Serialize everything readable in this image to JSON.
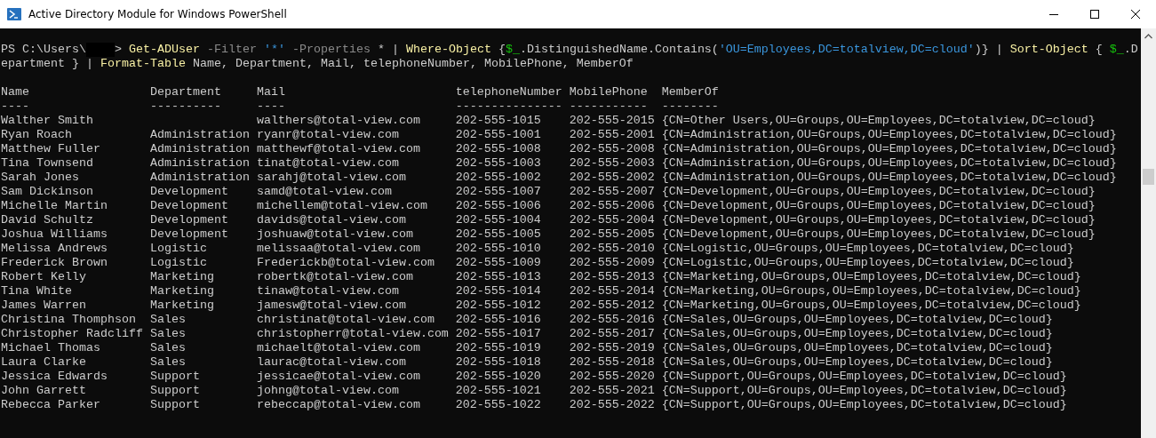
{
  "window": {
    "title": "Active Directory Module for Windows PowerShell"
  },
  "command_lines": [
    [
      {
        "kind": "plain",
        "text": "PS C:\\Users\\"
      },
      {
        "kind": "redacted"
      },
      {
        "kind": "plain",
        "text": "> "
      },
      {
        "kind": "command",
        "text": "Get-ADUser"
      },
      {
        "kind": "parameter",
        "text": " -Filter"
      },
      {
        "kind": "string",
        "text": " '*'"
      },
      {
        "kind": "parameter",
        "text": " -Properties"
      },
      {
        "kind": "plain",
        "text": " * | "
      },
      {
        "kind": "command",
        "text": "Where-Object"
      },
      {
        "kind": "plain",
        "text": " {"
      },
      {
        "kind": "variable",
        "text": "$_"
      },
      {
        "kind": "plain",
        "text": ".DistinguishedName.Contains("
      },
      {
        "kind": "string",
        "text": "'OU=Employees,DC=totalview,DC=cloud'"
      },
      {
        "kind": "plain",
        "text": ")} | "
      },
      {
        "kind": "command",
        "text": "Sort-Object"
      },
      {
        "kind": "plain",
        "text": " { "
      },
      {
        "kind": "variable",
        "text": "$_"
      },
      {
        "kind": "plain",
        "text": ".D"
      }
    ],
    [
      {
        "kind": "plain",
        "text": "epartment } | "
      },
      {
        "kind": "command",
        "text": "Format-Table"
      },
      {
        "kind": "plain",
        "text": " Name, Department, Mail, telephoneNumber, MobilePhone, MemberOf"
      }
    ]
  ],
  "table": {
    "columns": [
      {
        "heading": "Name",
        "rule": "----"
      },
      {
        "heading": "Department",
        "rule": "----------"
      },
      {
        "heading": "Mail",
        "rule": "----"
      },
      {
        "heading": "telephoneNumber",
        "rule": "---------------"
      },
      {
        "heading": "MobilePhone",
        "rule": "-----------"
      },
      {
        "heading": "MemberOf",
        "rule": "--------"
      }
    ],
    "rows": [
      [
        "Walther Smith",
        "",
        "walthers@total-view.com",
        "202-555-1015",
        "202-555-2015",
        "{CN=Other Users,OU=Groups,OU=Employees,DC=totalview,DC=cloud}"
      ],
      [
        "Ryan Roach",
        "Administration",
        "ryanr@total-view.com",
        "202-555-1001",
        "202-555-2001",
        "{CN=Administration,OU=Groups,OU=Employees,DC=totalview,DC=cloud}"
      ],
      [
        "Matthew Fuller",
        "Administration",
        "matthewf@total-view.com",
        "202-555-1008",
        "202-555-2008",
        "{CN=Administration,OU=Groups,OU=Employees,DC=totalview,DC=cloud}"
      ],
      [
        "Tina Townsend",
        "Administration",
        "tinat@total-view.com",
        "202-555-1003",
        "202-555-2003",
        "{CN=Administration,OU=Groups,OU=Employees,DC=totalview,DC=cloud}"
      ],
      [
        "Sarah Jones",
        "Administration",
        "sarahj@total-view.com",
        "202-555-1002",
        "202-555-2002",
        "{CN=Administration,OU=Groups,OU=Employees,DC=totalview,DC=cloud}"
      ],
      [
        "Sam Dickinson",
        "Development",
        "samd@total-view.com",
        "202-555-1007",
        "202-555-2007",
        "{CN=Development,OU=Groups,OU=Employees,DC=totalview,DC=cloud}"
      ],
      [
        "Michelle Martin",
        "Development",
        "michellem@total-view.com",
        "202-555-1006",
        "202-555-2006",
        "{CN=Development,OU=Groups,OU=Employees,DC=totalview,DC=cloud}"
      ],
      [
        "David Schultz",
        "Development",
        "davids@total-view.com",
        "202-555-1004",
        "202-555-2004",
        "{CN=Development,OU=Groups,OU=Employees,DC=totalview,DC=cloud}"
      ],
      [
        "Joshua Williams",
        "Development",
        "joshuaw@total-view.com",
        "202-555-1005",
        "202-555-2005",
        "{CN=Development,OU=Groups,OU=Employees,DC=totalview,DC=cloud}"
      ],
      [
        "Melissa Andrews",
        "Logistic",
        "melissaa@total-view.com",
        "202-555-1010",
        "202-555-2010",
        "{CN=Logistic,OU=Groups,OU=Employees,DC=totalview,DC=cloud}"
      ],
      [
        "Frederick Brown",
        "Logistic",
        "Frederickb@total-view.com",
        "202-555-1009",
        "202-555-2009",
        "{CN=Logistic,OU=Groups,OU=Employees,DC=totalview,DC=cloud}"
      ],
      [
        "Robert Kelly",
        "Marketing",
        "robertk@total-view.com",
        "202-555-1013",
        "202-555-2013",
        "{CN=Marketing,OU=Groups,OU=Employees,DC=totalview,DC=cloud}"
      ],
      [
        "Tina White",
        "Marketing",
        "tinaw@total-view.com",
        "202-555-1014",
        "202-555-2014",
        "{CN=Marketing,OU=Groups,OU=Employees,DC=totalview,DC=cloud}"
      ],
      [
        "James Warren",
        "Marketing",
        "jamesw@total-view.com",
        "202-555-1012",
        "202-555-2012",
        "{CN=Marketing,OU=Groups,OU=Employees,DC=totalview,DC=cloud}"
      ],
      [
        "Christina Thomphson",
        "Sales",
        "christinat@total-view.com",
        "202-555-1016",
        "202-555-2016",
        "{CN=Sales,OU=Groups,OU=Employees,DC=totalview,DC=cloud}"
      ],
      [
        "Christopher Radcliff",
        "Sales",
        "christopherr@total-view.com",
        "202-555-1017",
        "202-555-2017",
        "{CN=Sales,OU=Groups,OU=Employees,DC=totalview,DC=cloud}"
      ],
      [
        "Michael Thomas",
        "Sales",
        "michaelt@total-view.com",
        "202-555-1019",
        "202-555-2019",
        "{CN=Sales,OU=Groups,OU=Employees,DC=totalview,DC=cloud}"
      ],
      [
        "Laura Clarke",
        "Sales",
        "laurac@total-view.com",
        "202-555-1018",
        "202-555-2018",
        "{CN=Sales,OU=Groups,OU=Employees,DC=totalview,DC=cloud}"
      ],
      [
        "Jessica Edwards",
        "Support",
        "jessicae@total-view.com",
        "202-555-1020",
        "202-555-2020",
        "{CN=Support,OU=Groups,OU=Employees,DC=totalview,DC=cloud}"
      ],
      [
        "John Garrett",
        "Support",
        "johng@total-view.com",
        "202-555-1021",
        "202-555-2021",
        "{CN=Support,OU=Groups,OU=Employees,DC=totalview,DC=cloud}"
      ],
      [
        "Rebecca Parker",
        "Support",
        "rebeccap@total-view.com",
        "202-555-1022",
        "202-555-2022",
        "{CN=Support,OU=Groups,OU=Employees,DC=totalview,DC=cloud}"
      ]
    ]
  }
}
